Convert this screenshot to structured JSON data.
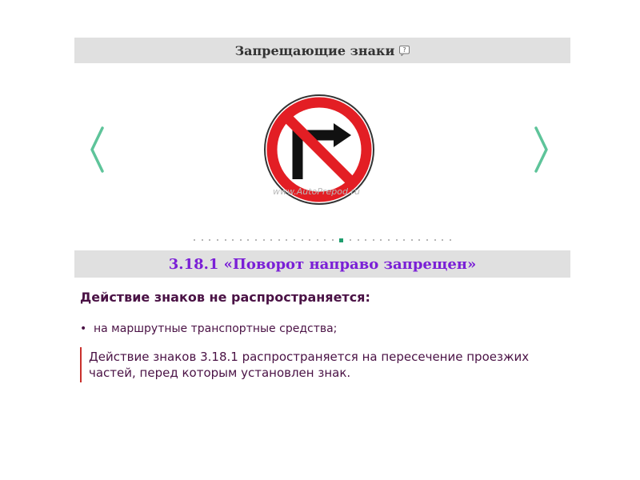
{
  "header": {
    "title": "Запрещающие знаки"
  },
  "slider": {
    "watermark": "www.AutoPrepod.ru",
    "dots_total": 34,
    "active_dot_index": 19,
    "colors": {
      "arrow": "#5ec49a",
      "active_dot": "#1f9e6e",
      "sign_ring": "#e31e24"
    }
  },
  "sign": {
    "title": "3.18.1 «Поворот направо запрещен»"
  },
  "content": {
    "heading": "Действие знаков не распространяется:",
    "exceptions": [
      "на маршрутные транспортные средства;"
    ],
    "note": "Действие знаков 3.18.1 распространяется на пересечение проезжих частей, перед которым установлен знак."
  }
}
